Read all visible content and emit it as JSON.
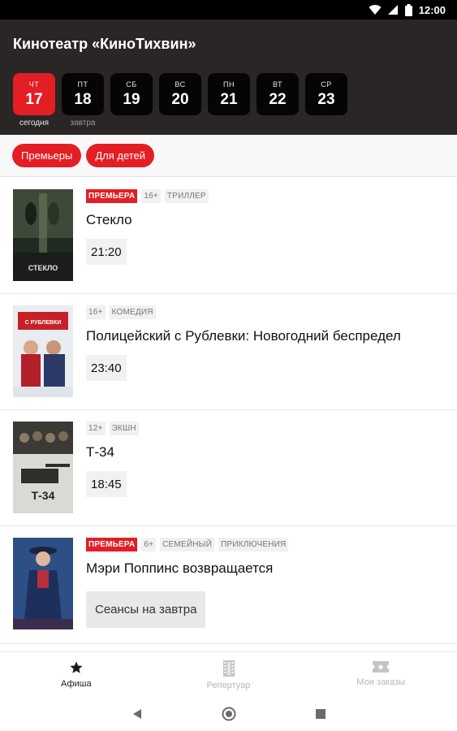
{
  "status": {
    "time": "12:00"
  },
  "header": {
    "title": "Кинотеатр «КиноТихвин»"
  },
  "dates": [
    {
      "dow": "ЧТ",
      "day": "17",
      "sub": "сегодня",
      "active": true
    },
    {
      "dow": "ПТ",
      "day": "18",
      "sub": "завтра"
    },
    {
      "dow": "СБ",
      "day": "19",
      "sub": ""
    },
    {
      "dow": "ВС",
      "day": "20",
      "sub": ""
    },
    {
      "dow": "ПН",
      "day": "21",
      "sub": ""
    },
    {
      "dow": "ВТ",
      "day": "22",
      "sub": ""
    },
    {
      "dow": "СР",
      "day": "23",
      "sub": ""
    }
  ],
  "filters": {
    "premieres": "Премьеры",
    "kids": "Для детей"
  },
  "movies": [
    {
      "premiere": "ПРЕМЬЕРА",
      "age": "16+",
      "genre1": "ТРИЛЛЕР",
      "title": "Стекло",
      "time": "21:20",
      "poster_text": "СТЕКЛО"
    },
    {
      "age": "16+",
      "genre1": "КОМЕДИЯ",
      "title": "Полицейский с Рублевки: Новогодний беспредел",
      "time": "23:40",
      "poster_text": "С РУБЛЕВКИ"
    },
    {
      "age": "12+",
      "genre1": "ЭКШН",
      "title": "Т-34",
      "time": "18:45",
      "poster_text": "Т-34"
    },
    {
      "premiere": "ПРЕМЬЕРА",
      "age": "6+",
      "genre1": "СЕМЕЙНЫЙ",
      "genre2": "ПРИКЛЮЧЕНИЯ",
      "title": "Мэри Поппинс возвращается",
      "tomorrow": "Сеансы на завтра"
    }
  ],
  "bottom_nav": {
    "afisha": "Афиша",
    "repertoire": "Репертуар",
    "orders": "Мои заказы"
  },
  "colors": {
    "accent": "#e31e24",
    "header_bg": "#2a2626"
  }
}
